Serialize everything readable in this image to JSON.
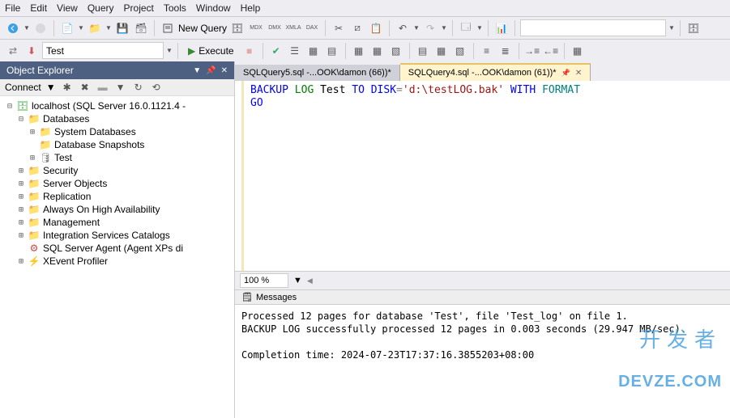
{
  "menu": {
    "items": [
      "File",
      "Edit",
      "View",
      "Query",
      "Project",
      "Tools",
      "Window",
      "Help"
    ]
  },
  "toolbar1": {
    "new_query": "New Query"
  },
  "toolbar2": {
    "db_combo": "Test",
    "execute": "Execute"
  },
  "explorer": {
    "title": "Object Explorer",
    "connect": "Connect",
    "server": "localhost (SQL Server 16.0.1121.4 -",
    "databases": "Databases",
    "sys_db": "System Databases",
    "snapshots": "Database Snapshots",
    "test_db": "Test",
    "security": "Security",
    "server_objects": "Server Objects",
    "replication": "Replication",
    "always_on": "Always On High Availability",
    "management": "Management",
    "isc": "Integration Services Catalogs",
    "agent": "SQL Server Agent (Agent XPs di",
    "xevent": "XEvent Profiler"
  },
  "tabs": {
    "t1": "SQLQuery5.sql -...OOK\\damon (66))*",
    "t2": "SQLQuery4.sql -...OOK\\damon (61))*"
  },
  "code": {
    "l1_kw1": "BACKUP",
    "l1_kw2": "LOG",
    "l1_id": " Test ",
    "l1_kw3": "TO",
    "l1_kw4": " DISK",
    "l1_op": "=",
    "l1_str": "'d:\\testLOG.bak'",
    "l1_kw5": " WITH",
    "l1_kw6": " FORMAT",
    "l2": "GO"
  },
  "zoom": "100 %",
  "messages": {
    "header": "Messages",
    "line1": "Processed 12 pages for database 'Test', file 'Test_log' on file 1.",
    "line2": "BACKUP LOG successfully processed 12 pages in 0.003 seconds (29.947 MB/sec).",
    "line3": "",
    "line4": "Completion time: 2024-07-23T17:37:16.3855203+08:00"
  },
  "watermark": {
    "l1": "开发者",
    "l2": "DEVZE.COM"
  }
}
